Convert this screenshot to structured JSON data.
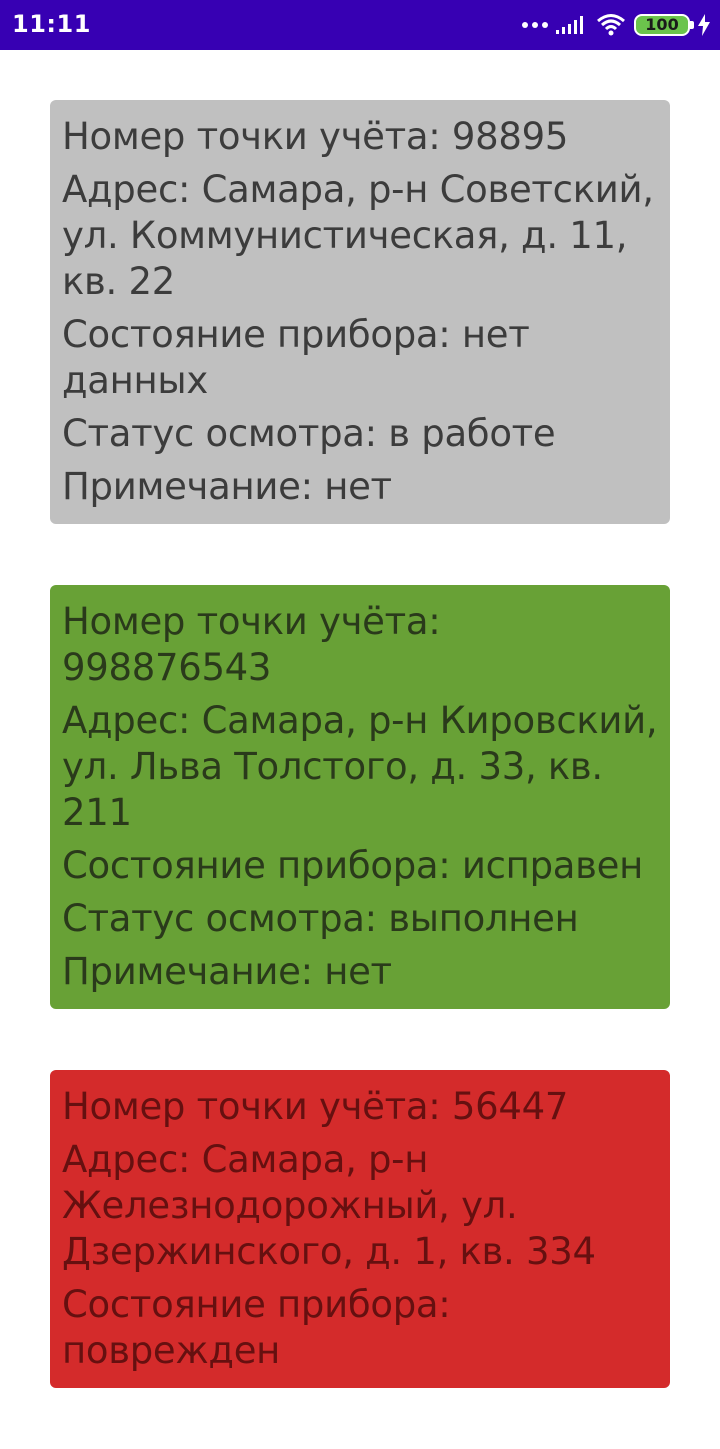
{
  "status_bar": {
    "time": "11:11",
    "battery": "100",
    "background": "#3700b3",
    "icons": [
      "more-dots-icon",
      "signal-icon",
      "wifi-icon",
      "battery-icon",
      "charging-bolt-icon"
    ]
  },
  "cards": [
    {
      "background": "#c0c0c0",
      "text_color": "#3c3c3c",
      "fields": [
        "Номер точки учёта: 98895",
        "Адрес: Самара, р-н Советский, ул. Коммунистическая, д. 11, кв. 22",
        "Состояние прибора: нет данных",
        "Статус осмотра: в работе",
        "Примечание: нет"
      ]
    },
    {
      "background": "#68a136",
      "text_color": "#2a3a1b",
      "fields": [
        "Номер точки учёта: 998876543",
        "Адрес: Самара, р-н Кировский, ул. Льва Толстого, д. 33, кв. 211",
        "Состояние прибора: исправен",
        "Статус осмотра: выполнен",
        "Примечание: нет"
      ]
    },
    {
      "background": "#d42b2b",
      "text_color": "#661010",
      "fields": [
        "Номер точки учёта: 56447",
        "Адрес: Самара, р-н Железнодорожный, ул. Дзержинского, д. 1, кв. 334",
        "Состояние прибора: поврежден"
      ]
    }
  ]
}
